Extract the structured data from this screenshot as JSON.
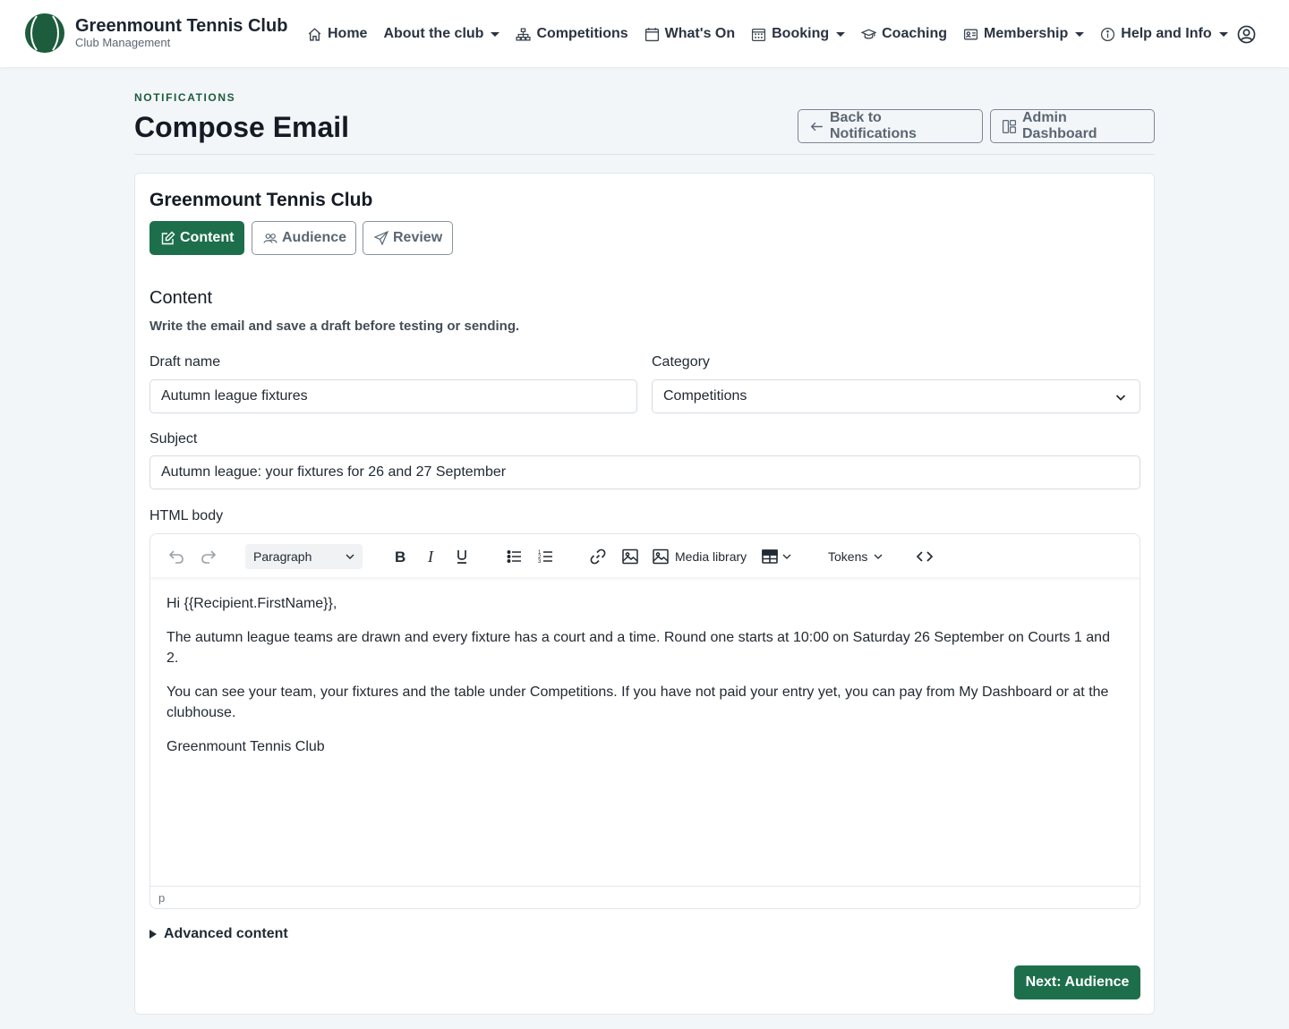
{
  "brand": {
    "title": "Greenmount Tennis Club",
    "subtitle": "Club Management"
  },
  "nav": {
    "items": [
      {
        "label": "Home",
        "icon": "home-icon"
      },
      {
        "label": "About the club",
        "icon": "",
        "dropdown": true
      },
      {
        "label": "Competitions",
        "icon": "sitemap-icon"
      },
      {
        "label": "What's On",
        "icon": "calendar-icon"
      },
      {
        "label": "Booking",
        "icon": "calendar-grid-icon",
        "dropdown": true
      },
      {
        "label": "Coaching",
        "icon": "mortarboard-icon"
      },
      {
        "label": "Membership",
        "icon": "id-card-icon",
        "dropdown": true
      },
      {
        "label": "Help and Info",
        "icon": "info-icon",
        "dropdown": true
      }
    ],
    "user_icon": "user-circle-icon"
  },
  "header": {
    "eyebrow": "NOTIFICATIONS",
    "title": "Compose Email",
    "back_label": "Back to Notifications",
    "admin_label": "Admin Dashboard"
  },
  "card": {
    "title": "Greenmount Tennis Club",
    "steps": [
      {
        "label": "Content",
        "active": true,
        "icon": "edit-icon"
      },
      {
        "label": "Audience",
        "active": false,
        "icon": "people-icon"
      },
      {
        "label": "Review",
        "active": false,
        "icon": "send-icon"
      }
    ],
    "section_title": "Content",
    "section_subtitle": "Write the email and save a draft before testing or sending.",
    "draft_name_label": "Draft name",
    "draft_name_value": "Autumn league fixtures",
    "category_label": "Category",
    "category_value": "Competitions",
    "subject_label": "Subject",
    "subject_value": "Autumn league: your fixtures for 26 and 27 September",
    "html_body_label": "HTML body"
  },
  "editor": {
    "block_format": "Paragraph",
    "media_library_label": "Media library",
    "tokens_label": "Tokens",
    "paragraphs": [
      "Hi {{Recipient.FirstName}},",
      "The autumn league teams are drawn and every fixture has a court and a time. Round one starts at 10:00 on Saturday 26 September on Courts 1 and 2.",
      "You can see your team, your fixtures and the table under Competitions. If you have not paid your entry yet, you can pay from My Dashboard or at the clubhouse.",
      "Greenmount Tennis Club"
    ],
    "status_path": "p"
  },
  "advanced_label": "Advanced content",
  "next_label": "Next: Audience",
  "colors": {
    "brand_green": "#1d6f4c",
    "logo_green": "#1d5c3c",
    "page_bg": "#f3f6f9"
  }
}
